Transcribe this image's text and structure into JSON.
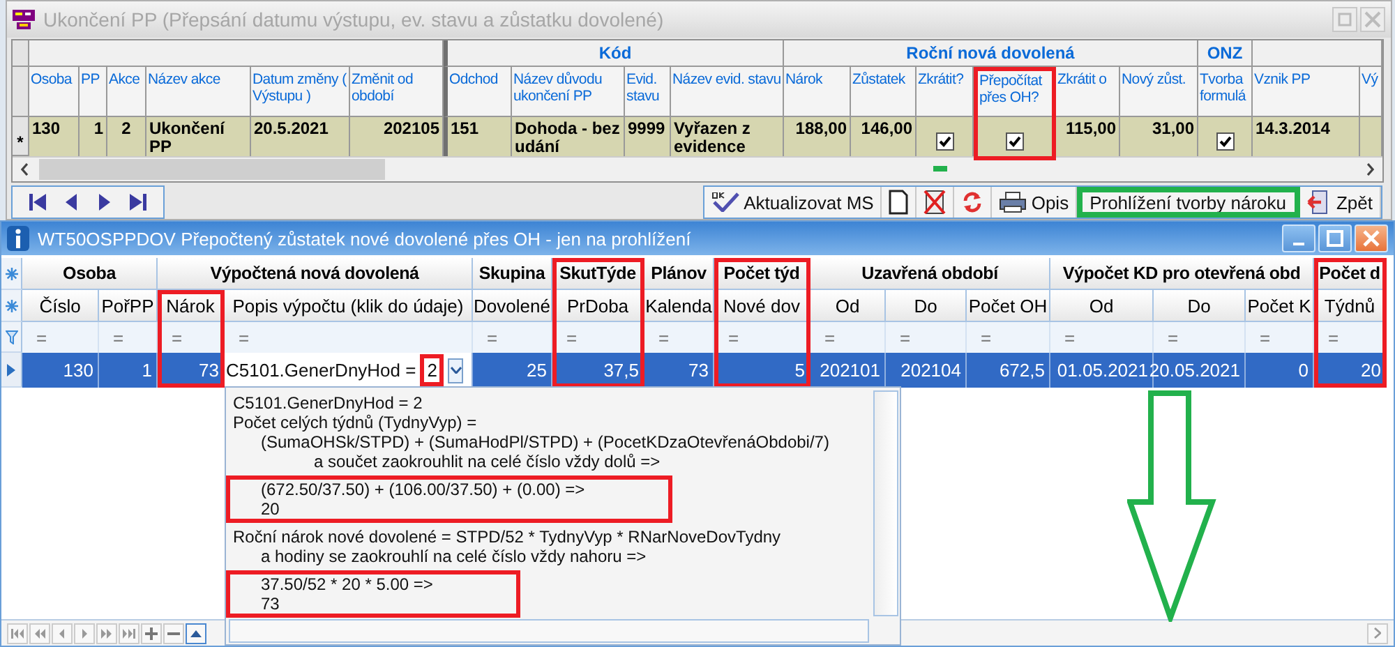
{
  "top_window": {
    "title": "Ukončení PP (Přepsání datumu výstupu, ev. stavu a zůstatku dovolené)",
    "title_buttons": [
      {
        "kind": "restore"
      },
      {
        "kind": "close"
      }
    ],
    "table": {
      "groups": [
        {
          "columns": [
            {
              "label": "Osoba"
            },
            {
              "label": "PP"
            },
            {
              "label": "Akce"
            },
            {
              "label": "Název akce"
            },
            {
              "label": "Datum změny ( Výstupu )"
            },
            {
              "label": "Změnit od období"
            }
          ]
        },
        {
          "label": "Kód",
          "columns": [
            {
              "label": "Odchod"
            },
            {
              "label": "Název důvodu ukončení PP"
            },
            {
              "label": "Evid. stavu"
            },
            {
              "label": "Název evid. stavu"
            }
          ]
        },
        {
          "label": "Roční nová dovolená",
          "columns": [
            {
              "label": "Nárok"
            },
            {
              "label": "Zůstatek"
            },
            {
              "label": "Zkrátit?"
            },
            {
              "label": "Přepočítat přes OH?",
              "highlighted": true
            },
            {
              "label": "Zkrátit o"
            },
            {
              "label": "Nový zůst."
            }
          ]
        },
        {
          "label": "ONZ",
          "columns": [
            {
              "label": "Tvorba formulá"
            }
          ]
        },
        {
          "columns": [
            {
              "label": "Vznik PP"
            },
            {
              "label": "Vý"
            }
          ]
        }
      ],
      "rows": [
        {
          "marker": "*",
          "cells": [
            "130",
            "1",
            "2",
            "Ukončení PP",
            "20.5.2021",
            "202105",
            "151",
            "Dohoda - bez udání",
            "9999",
            "Vyřazen z evidence",
            "188,00",
            "146,00",
            {
              "checked": true
            },
            {
              "checked": true
            },
            "115,00",
            "31,00",
            {
              "checked": true
            },
            "14.3.2014",
            null
          ]
        }
      ]
    },
    "navigation": [
      {
        "kind": "first"
      },
      {
        "kind": "prev"
      },
      {
        "kind": "next"
      },
      {
        "kind": "last"
      }
    ],
    "toolbar": [
      {
        "kind": "update",
        "label": "Aktualizovat MS",
        "highlighted": false
      },
      {
        "kind": "new",
        "highlighted": false
      },
      {
        "kind": "delete",
        "highlighted": false
      },
      {
        "kind": "refresh",
        "highlighted": false
      },
      {
        "kind": "print",
        "label": "Opis",
        "highlighted": false
      },
      {
        "kind": "text",
        "label": "Prohlížení tvorby nároku",
        "highlighted": true
      },
      {
        "kind": "back",
        "label": "Zpět",
        "highlighted": false
      }
    ]
  },
  "lower_window": {
    "title": "WT50OSPPDOV Přepočtený zůstatek nové dovolené přes OH - jen na prohlížení",
    "title_buttons": [
      {
        "kind": "minimize"
      },
      {
        "kind": "maximize"
      },
      {
        "kind": "close"
      }
    ],
    "table": {
      "groups": [
        {
          "label": "Osoba",
          "columns": [
            {
              "label": "Číslo"
            },
            {
              "label": "PořPP"
            }
          ]
        },
        {
          "label": "Výpočtená nová dovolená",
          "columns": [
            {
              "label": "Nárok",
              "highlighted": true
            },
            {
              "label": "Popis výpočtu (klik do údaje)"
            }
          ]
        },
        {
          "label": "Skupina",
          "columns": [
            {
              "label": "Dovolené"
            }
          ]
        },
        {
          "label": "SkutTýde",
          "columns": [
            {
              "label": "PrDoba",
              "highlighted": true
            }
          ]
        },
        {
          "label": "Plánov",
          "columns": [
            {
              "label": "Kalenda"
            }
          ]
        },
        {
          "label": "Počet týd",
          "columns": [
            {
              "label": "Nové dov",
              "highlighted": true
            }
          ]
        },
        {
          "label": "Uzavřená období",
          "columns": [
            {
              "label": "Od"
            },
            {
              "label": "Do"
            },
            {
              "label": "Počet OH"
            }
          ]
        },
        {
          "label": "Výpočet KD pro otevřená obd",
          "columns": [
            {
              "label": "Od"
            },
            {
              "label": "Do"
            },
            {
              "label": "Počet K"
            }
          ]
        },
        {
          "label": "Počet d",
          "columns": [
            {
              "label": "Týdnů",
              "highlighted": true
            }
          ]
        }
      ],
      "filters": [
        "=",
        "=",
        "=",
        "=",
        "=",
        "=",
        "=",
        "=",
        "=",
        "=",
        "=",
        "=",
        "=",
        "=",
        "="
      ],
      "rows": [
        {
          "selected": true,
          "cells": [
            "130",
            "1",
            "73",
            {
              "kind": "combo",
              "label": "C5101.GenerDnyHod =",
              "value": "2",
              "highlighted": true
            },
            "25",
            "37,5",
            "73",
            "5",
            "202101",
            "202104",
            "672,5",
            "01.05.2021",
            "20.05.2021",
            "0",
            "20"
          ]
        }
      ]
    },
    "dropdown": {
      "blocks": [
        {
          "lines": [
            {
              "kind": "statement",
              "text": "C5101.GenerDnyHod = 2"
            },
            {
              "kind": "statement",
              "text": "Počet celých týdnů (TydnyVyp) ="
            },
            {
              "kind": "operand",
              "text": "(SumaOHSk/STPD) + (SumaHodPl/STPD) + (PocetKDzaOtevřenáObdobi/7)"
            },
            {
              "kind": "note",
              "text": "a součet zaokrouhlit na celé číslo vždy dolů  =>"
            }
          ]
        },
        {
          "highlighted": true,
          "lines": [
            {
              "kind": "operand",
              "text": "(672.50/37.50) + (106.00/37.50) + (0.00)  =>"
            },
            {
              "kind": "operand",
              "text": "20"
            }
          ]
        },
        {
          "lines": [
            {
              "kind": "statement",
              "text": "Roční nárok nové dovolené = STPD/52 * TydnyVyp * RNarNoveDovTydny"
            },
            {
              "kind": "operand",
              "text": "a hodiny se zaokrouhlí na celé číslo vždy nahoru  =>"
            }
          ]
        },
        {
          "highlighted": true,
          "lines": [
            {
              "kind": "operand",
              "text": "37.50/52 * 20 * 5.00  =>"
            },
            {
              "kind": "operand",
              "text": "73"
            }
          ]
        }
      ]
    },
    "navigation": [
      {
        "kind": "first"
      },
      {
        "kind": "prev-page"
      },
      {
        "kind": "prev"
      },
      {
        "kind": "next"
      },
      {
        "kind": "next-page"
      },
      {
        "kind": "last"
      },
      {
        "kind": "add"
      },
      {
        "kind": "remove"
      },
      {
        "kind": "up"
      }
    ]
  }
}
